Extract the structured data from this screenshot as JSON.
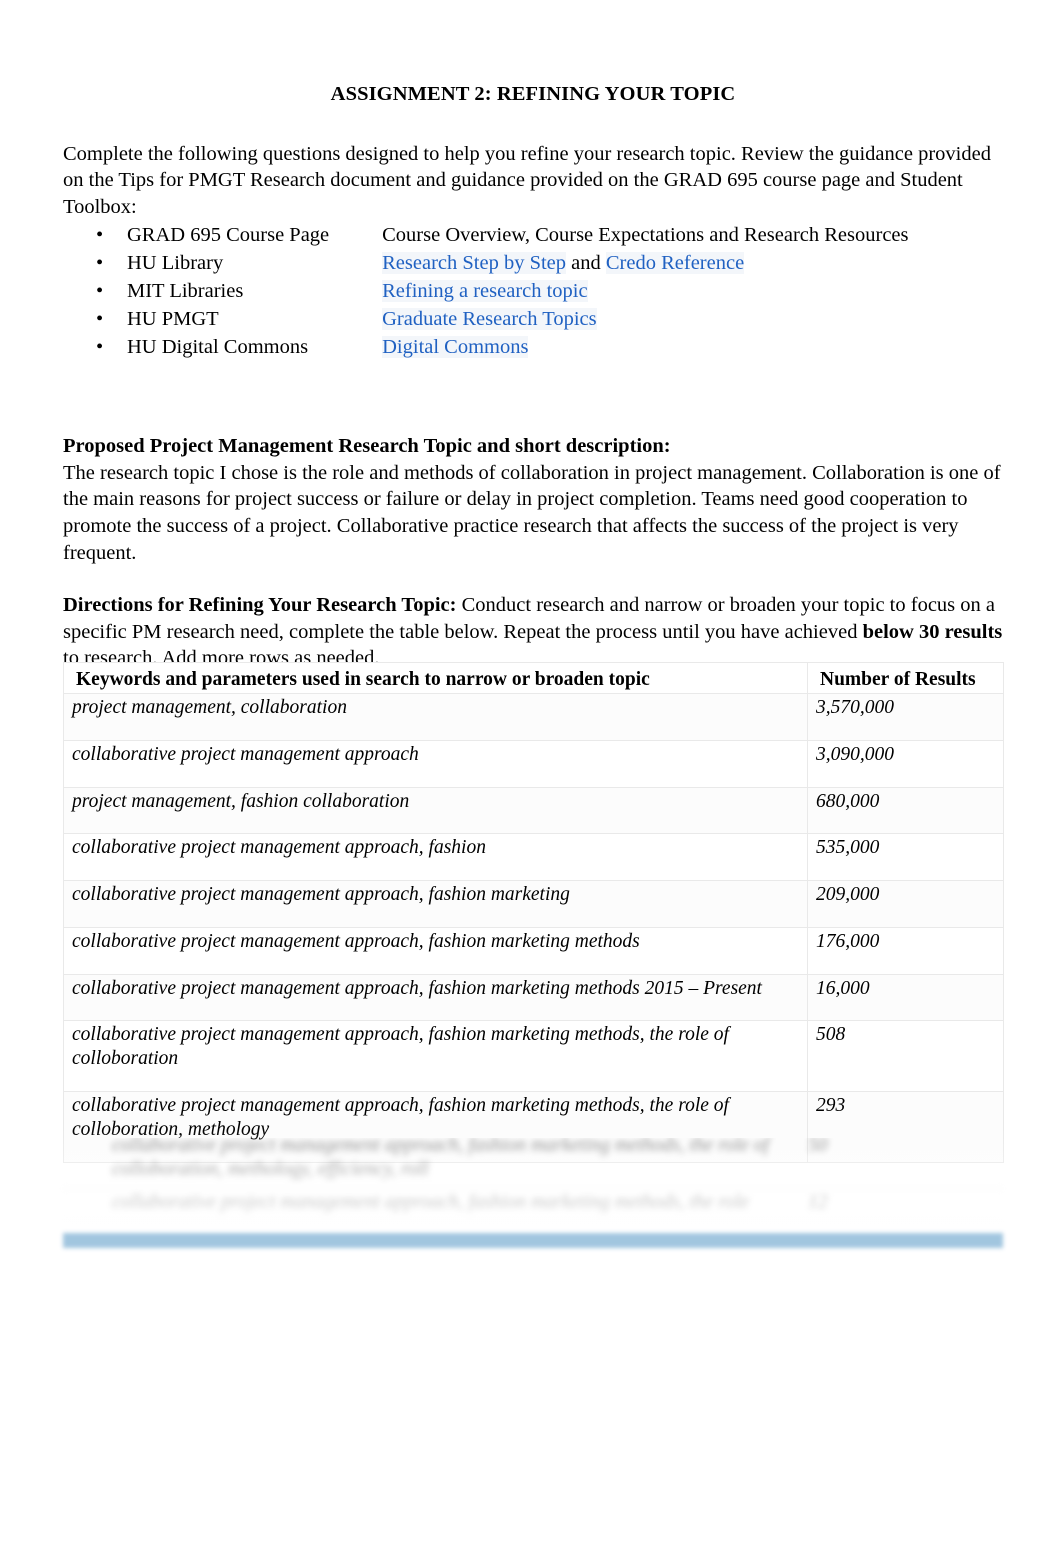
{
  "document": {
    "title": "ASSIGNMENT 2: REFINING YOUR TOPIC",
    "intro": "Complete the following questions designed to help you refine your research topic. Review the guidance provided on the Tips for PMGT Research document and guidance provided on the GRAD 695 course page and Student Toolbox:",
    "bullets": [
      {
        "marker": "•",
        "label": "GRAD 695 Course Page",
        "value": "Course Overview, Course Expectations and Research Resources",
        "is_link": false
      },
      {
        "marker": "•",
        "label": "HU Library",
        "link1": "Research Step by Step",
        "conjunction": " and ",
        "link2": "Credo Reference",
        "is_link": true
      },
      {
        "marker": "•",
        "label": "MIT Libraries",
        "link1": "Refining a research topic",
        "is_link": true
      },
      {
        "marker": "•",
        "label": "HU PMGT",
        "link1": "Graduate Research Topics",
        "is_link": true
      },
      {
        "marker": "•",
        "label": "HU Digital Commons",
        "link1": "Digital Commons",
        "is_link": true
      }
    ],
    "proposed": {
      "heading": "Proposed Project Management Research Topic and short description:",
      "body": "The research topic I chose is the role and methods of collaboration in project management. Collaboration is one of the main reasons for project success or failure or delay in project completion. Teams need good cooperation to promote the success of a project. Collaborative practice research that affects the success of the project is very frequent."
    },
    "directions": {
      "heading": "Directions for Refining Your Research Topic:",
      "part1": " Conduct research and narrow or broaden your topic to focus on a specific PM research need, complete the table below. Repeat the process until you have achieved ",
      "emphasis": "below 30 results",
      "part2": " to research. Add more rows as needed."
    },
    "table": {
      "headers": [
        "Keywords and parameters used in search to narrow or broaden topic",
        "Number of Results"
      ],
      "rows": [
        {
          "keywords": "project management, collaboration",
          "results": "3,570,000",
          "indent": false
        },
        {
          "keywords": "collaborative project management approach",
          "results": "3,090,000",
          "indent": false
        },
        {
          "keywords": "project management, fashion collaboration",
          "results": "680,000",
          "indent": false
        },
        {
          "keywords": "collaborative project management approach, fashion",
          "results": "535,000",
          "indent": false
        },
        {
          "keywords": "collaborative project management approach, fashion marketing",
          "results": "209,000",
          "indent": false
        },
        {
          "keywords": "collaborative project management approach, fashion marketing methods",
          "results": "176,000",
          "indent": false
        },
        {
          "keywords": "collaborative project management approach, fashion marketing methods  2015 – Present",
          "results": "16,000",
          "indent": false
        },
        {
          "keywords": "collaborative project management approach, fashion marketing methods, the role of colloboration",
          "results": "508",
          "indent": true
        },
        {
          "keywords": "collaborative project management approach, fashion marketing methods, the role of colloboration, methology",
          "results": "293",
          "indent": true
        }
      ],
      "obscured_rows": [
        {
          "keywords": "collaborative project management approach, fashion marketing methods, the role of colloboration, methology, efficiency, roll",
          "results": "50",
          "indent": true
        },
        {
          "keywords": "collaborative project management approach, fashion marketing methods, the role",
          "results": "12",
          "indent": true
        }
      ]
    },
    "colors": {
      "link_blue": "#2061c2",
      "accent_bar": "#9dc3de",
      "text": "#000000",
      "table_border": "#e9e9e9"
    }
  }
}
